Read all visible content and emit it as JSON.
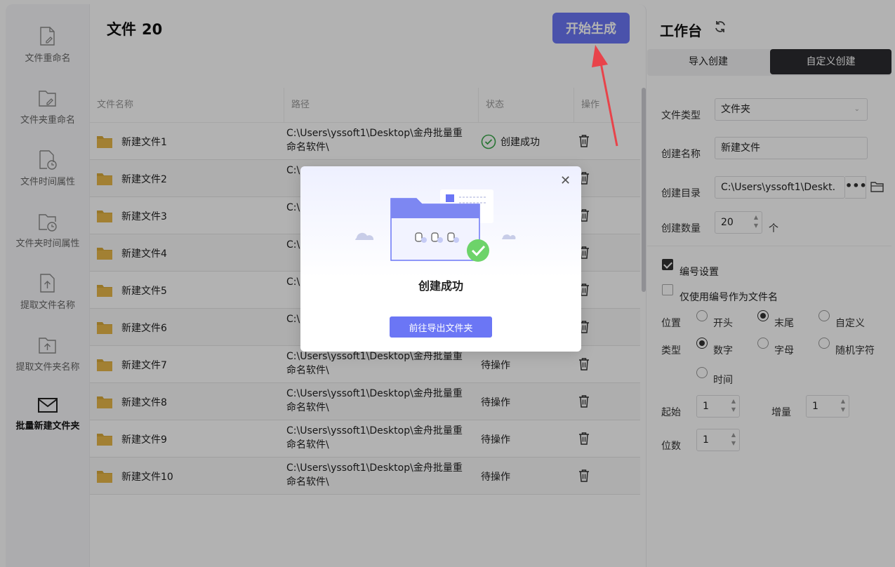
{
  "sidebar": {
    "items": [
      {
        "label": "文件重命名",
        "icon": "file-edit-icon"
      },
      {
        "label": "文件夹重命名",
        "icon": "folder-edit-icon"
      },
      {
        "label": "文件时间属性",
        "icon": "file-clock-icon"
      },
      {
        "label": "文件夹时间属性",
        "icon": "folder-clock-icon"
      },
      {
        "label": "提取文件名称",
        "icon": "file-extract-icon"
      },
      {
        "label": "提取文件夹名称",
        "icon": "folder-extract-icon"
      },
      {
        "label": "批量新建文件夹",
        "icon": "mail-box-icon",
        "active": true
      }
    ]
  },
  "main": {
    "title": "文件",
    "count": "20",
    "start_button": "开始生成",
    "columns": [
      "文件名称",
      "路径",
      "状态",
      "操作"
    ],
    "rows": [
      {
        "name": "新建文件1",
        "path": "C:\\Users\\yssoft1\\Desktop\\金舟批量重命名软件\\",
        "status": "创建成功",
        "success": true
      },
      {
        "name": "新建文件2",
        "path": "C:\\",
        "status": "",
        "success": false
      },
      {
        "name": "新建文件3",
        "path": "C:\\",
        "status": "",
        "success": false
      },
      {
        "name": "新建文件4",
        "path": "C:\\",
        "status": "",
        "success": false
      },
      {
        "name": "新建文件5",
        "path": "C:\\",
        "status": "",
        "success": false
      },
      {
        "name": "新建文件6",
        "path": "C:\\",
        "status": "",
        "success": false
      },
      {
        "name": "新建文件7",
        "path": "C:\\Users\\yssoft1\\Desktop\\金舟批量重命名软件\\",
        "status": "待操作",
        "success": false
      },
      {
        "name": "新建文件8",
        "path": "C:\\Users\\yssoft1\\Desktop\\金舟批量重命名软件\\",
        "status": "待操作",
        "success": false
      },
      {
        "name": "新建文件9",
        "path": "C:\\Users\\yssoft1\\Desktop\\金舟批量重命名软件\\",
        "status": "待操作",
        "success": false
      },
      {
        "name": "新建文件10",
        "path": "C:\\Users\\yssoft1\\Desktop\\金舟批量重命名软件\\",
        "status": "待操作",
        "success": false
      }
    ]
  },
  "panel": {
    "title": "工作台",
    "tabs": [
      "导入创建",
      "自定义创建"
    ],
    "file_type_label": "文件类型",
    "file_type_value": "文件夹",
    "name_label": "创建名称",
    "name_value": "新建文件",
    "dir_label": "创建目录",
    "dir_value": "C:\\Users\\yssoft1\\Deskt.",
    "dir_more": "•••",
    "count_label": "创建数量",
    "count_value": "20",
    "count_unit": "个",
    "numbering_label": "编号设置",
    "only_number_label": "仅使用编号作为文件名",
    "position_label": "位置",
    "position_options": [
      "开头",
      "末尾",
      "自定义"
    ],
    "type_label": "类型",
    "type_options": [
      "数字",
      "字母",
      "随机字符",
      "时间"
    ],
    "start_label": "起始",
    "start_value": "1",
    "increment_label": "增量",
    "increment_value": "1",
    "digits_label": "位数",
    "digits_value": "1"
  },
  "dialog": {
    "message": "创建成功",
    "button": "前往导出文件夹"
  },
  "colors": {
    "accent": "#6b76f5",
    "success": "#3aa84a",
    "folder": "#e8b84a",
    "arrow": "#e8434a"
  }
}
